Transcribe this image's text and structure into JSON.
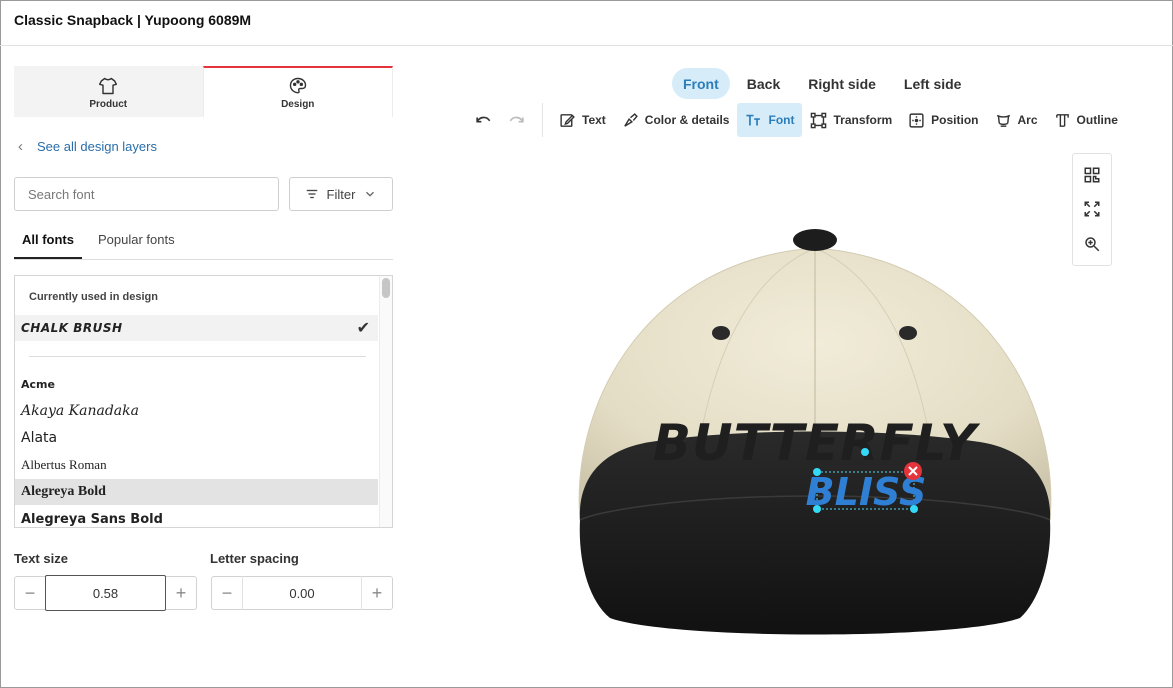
{
  "header": {
    "title": "Classic Snapback | Yupoong 6089M"
  },
  "mode_tabs": [
    {
      "label": "Product",
      "icon": "shirt-icon",
      "active": false
    },
    {
      "label": "Design",
      "icon": "palette-icon",
      "active": true
    }
  ],
  "back_link": {
    "label": "See all design layers"
  },
  "search": {
    "placeholder": "Search font",
    "value": ""
  },
  "filter": {
    "label": "Filter"
  },
  "font_tabs": [
    {
      "label": "All fonts",
      "active": true
    },
    {
      "label": "Popular fonts",
      "active": false
    }
  ],
  "font_list": {
    "section_label": "Currently used in design",
    "current_font": "CHALK BRUSH",
    "fonts": [
      "Acme",
      "Akaya Kanadaka",
      "Alata",
      "Albertus Roman",
      "Alegreya Bold",
      "Alegreya Sans Bold"
    ],
    "highlighted": "Alegreya Bold"
  },
  "text_size": {
    "label": "Text size",
    "value": "0.58"
  },
  "letter_spacing": {
    "label": "Letter spacing",
    "value": "0.00"
  },
  "view_tabs": [
    {
      "label": "Front",
      "active": true
    },
    {
      "label": "Back",
      "active": false
    },
    {
      "label": "Right side",
      "active": false
    },
    {
      "label": "Left side",
      "active": false
    }
  ],
  "toolbar": {
    "undo_icon": "undo-icon",
    "redo_icon": "redo-icon",
    "items": [
      {
        "label": "Text",
        "icon": "edit-text-icon",
        "active": false
      },
      {
        "label": "Color & details",
        "icon": "paint-icon",
        "active": false
      },
      {
        "label": "Font",
        "icon": "font-icon",
        "active": true
      },
      {
        "label": "Transform",
        "icon": "transform-icon",
        "active": false
      },
      {
        "label": "Position",
        "icon": "position-icon",
        "active": false
      },
      {
        "label": "Arc",
        "icon": "arc-icon",
        "active": false
      },
      {
        "label": "Outline",
        "icon": "outline-icon",
        "active": false
      }
    ]
  },
  "preview": {
    "line1": "BUTTERFLY",
    "line2": "BLISS",
    "line1_color": "#1f1f1f",
    "line2_color": "#2f80d4",
    "cap_crown_color": "#e8e2cd",
    "cap_brim_color": "#1b1b1b"
  },
  "colors": {
    "accent": "#2c7db8",
    "active_bg": "#d6ecf8",
    "tab_indicator": "#e5333c"
  }
}
